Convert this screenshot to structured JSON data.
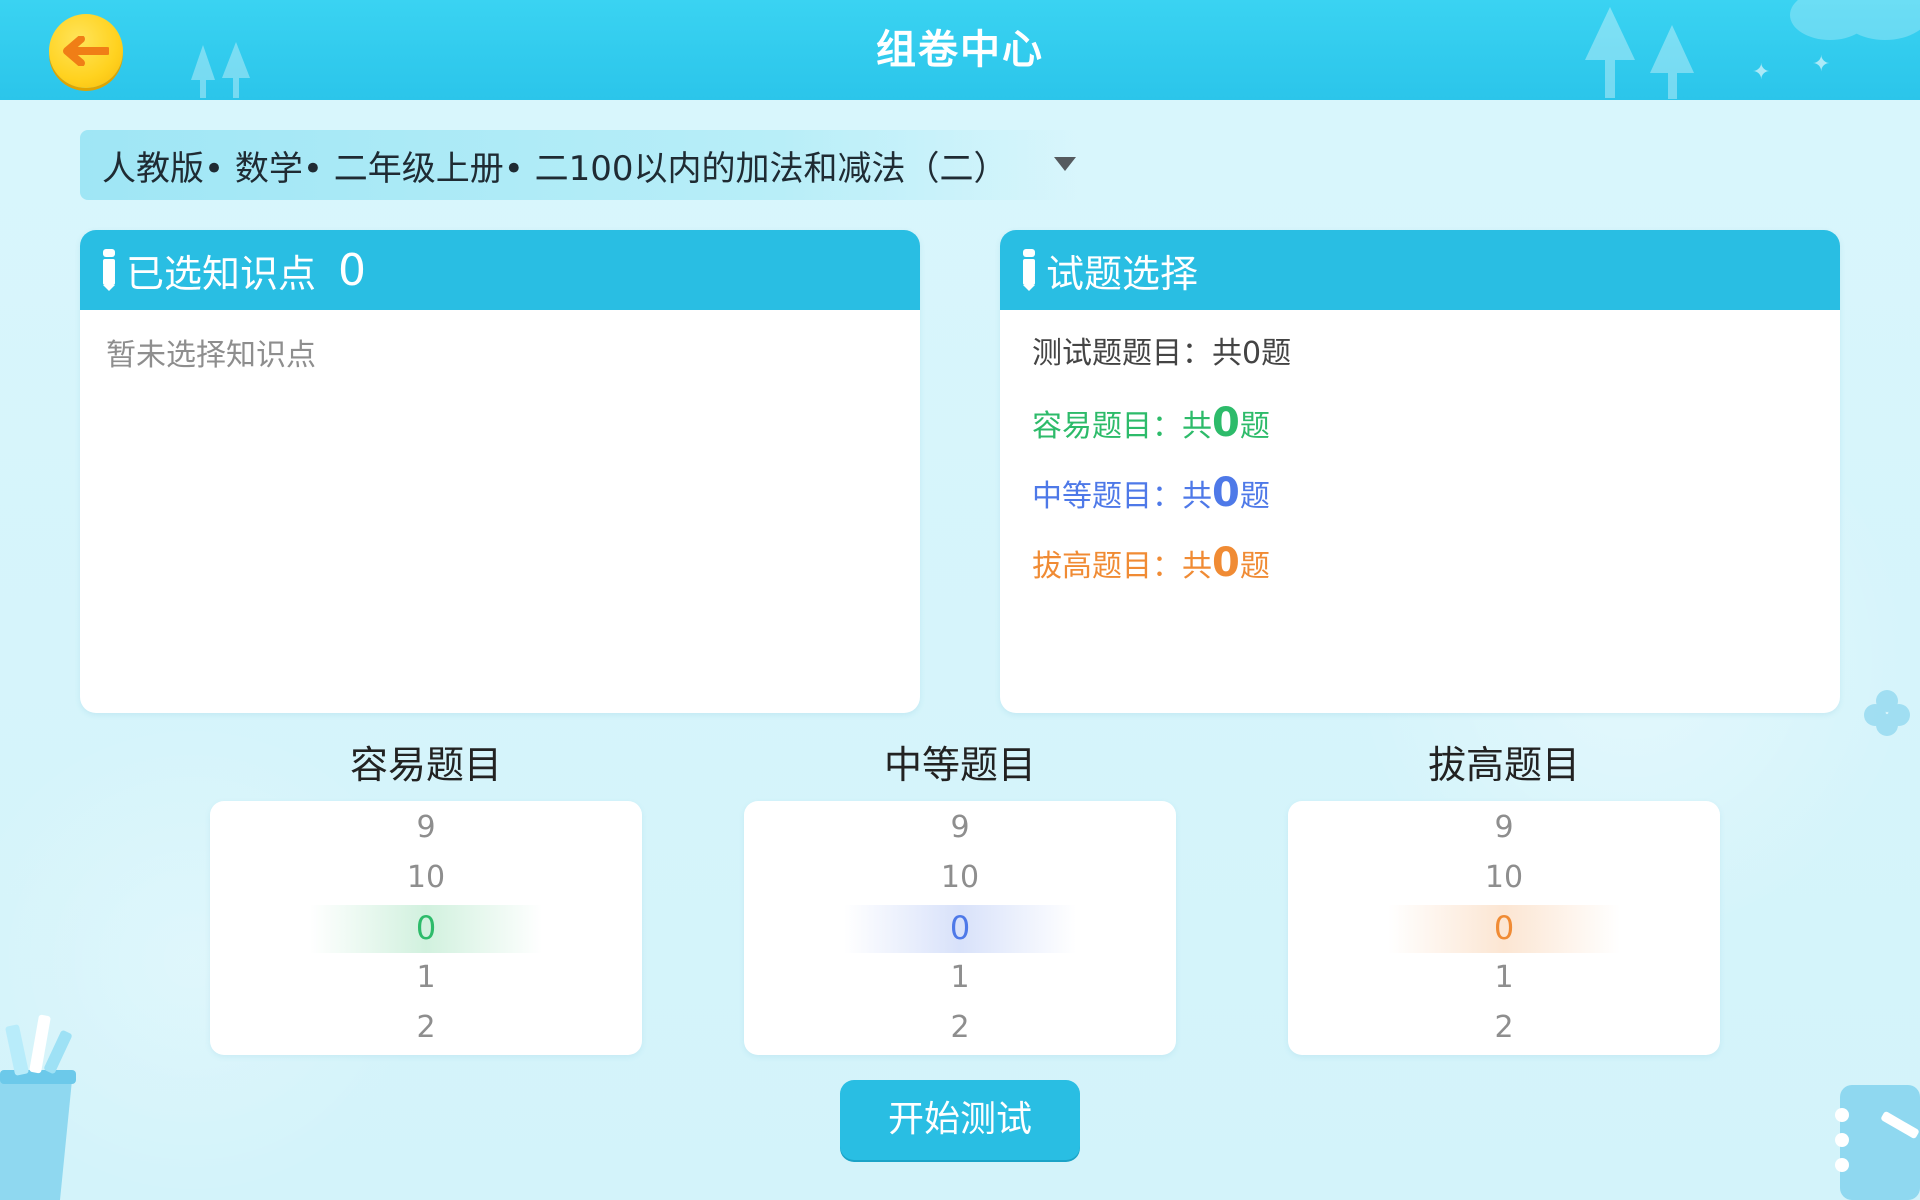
{
  "header": {
    "title": "组卷中心",
    "back_icon": "back-arrow-icon",
    "accent_color": "#2bc5ea",
    "back_button_color": "#ffd21f"
  },
  "selector": {
    "text": "人教版• 数学• 二年级上册• 二100以内的加法和减法（二）",
    "dropdown_icon": "caret-down-icon"
  },
  "knowledge_panel": {
    "title": "已选知识点",
    "count": "0",
    "empty_text": "暂未选择知识点",
    "icon": "pen-icon"
  },
  "question_panel": {
    "title": "试题选择",
    "icon": "pen-icon",
    "total": {
      "label": "测试题题目：",
      "prefix": "共",
      "count": "0",
      "suffix": "题"
    },
    "easy": {
      "label": "容易题目：",
      "prefix": "共",
      "count": "0",
      "suffix": "题",
      "color": "#2dbb6a"
    },
    "medium": {
      "label": "中等题目：",
      "prefix": "共",
      "count": "0",
      "suffix": "题",
      "color": "#4e79e8"
    },
    "hard": {
      "label": "拔高题目：",
      "prefix": "共",
      "count": "0",
      "suffix": "题",
      "color": "#f08b34"
    }
  },
  "pickers": {
    "easy": {
      "title": "容易题目",
      "rows": [
        "9",
        "10",
        "0",
        "1",
        "2"
      ],
      "selected": "0"
    },
    "medium": {
      "title": "中等题目",
      "rows": [
        "9",
        "10",
        "0",
        "1",
        "2"
      ],
      "selected": "0"
    },
    "hard": {
      "title": "拔高题目",
      "rows": [
        "9",
        "10",
        "0",
        "1",
        "2"
      ],
      "selected": "0"
    }
  },
  "start_button": {
    "label": "开始测试"
  }
}
